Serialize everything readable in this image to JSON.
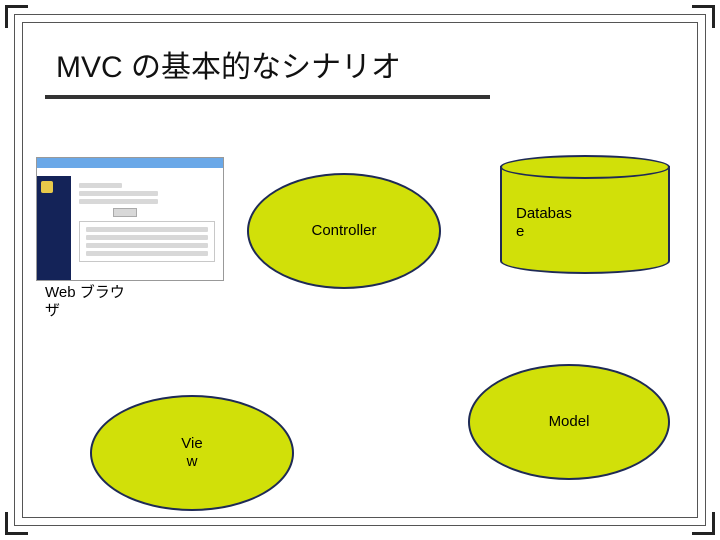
{
  "title": "MVC の基本的なシナリオ",
  "nodes": {
    "controller": "Controller",
    "database": "Databas\ne",
    "view": "Vie\nw",
    "model": "Model"
  },
  "browser_label": "Web ブラウ\nザ",
  "chart_data": {
    "type": "diagram",
    "title": "MVC の基本的なシナリオ",
    "nodes": [
      {
        "id": "browser",
        "label": "Web ブラウザ",
        "shape": "screenshot"
      },
      {
        "id": "controller",
        "label": "Controller",
        "shape": "ellipse"
      },
      {
        "id": "database",
        "label": "Database",
        "shape": "cylinder"
      },
      {
        "id": "view",
        "label": "View",
        "shape": "ellipse"
      },
      {
        "id": "model",
        "label": "Model",
        "shape": "ellipse"
      }
    ],
    "edges": []
  }
}
